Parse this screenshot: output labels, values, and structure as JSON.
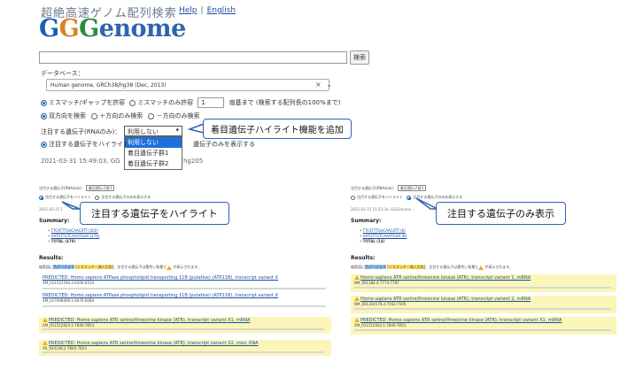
{
  "header": {
    "logo_subtitle": "超絶高速ゲノム配列検索",
    "logo": {
      "g1": "G",
      "g2": "G",
      "g3": "G",
      "rest": "enome"
    },
    "help_link": "Help",
    "separator": "|",
    "english_link": "English"
  },
  "search": {
    "button_label": "検索"
  },
  "database": {
    "label": "データベース：",
    "selected": "Human genome, GRCh38/hg38 (Dec, 2013)"
  },
  "options": {
    "mismatch_gap": "ミスマッチ/ギャップを許容",
    "mismatch_only": "ミスマッチのみ許容",
    "count_value": "1",
    "count_suffix": "塩基まで (検索する配列長の100%まで)",
    "both_strands": "双方向を検索",
    "plus_only": "＋方向のみ検索",
    "minus_only": "－方向のみ検索"
  },
  "gene_filter": {
    "label": "注目する遺伝子(RNAのみ)：",
    "selected": "利用しない",
    "options": [
      "利用しない",
      "着目遺伝子群1",
      "着目遺伝子群2"
    ],
    "highlight_radio": "注目する遺伝子をハイライト",
    "show_only_radio": "遺伝子のみを表示する"
  },
  "timestamp": "2021-03-31 15:49:03, GG",
  "timestamp_tail": "hg205",
  "callouts": {
    "top": "着目遺伝子ハイライト機能を追加",
    "left": "注目する遺伝子をハイライト",
    "right": "注目する遺伝子のみ表示"
  },
  "left_panel": {
    "filter_label": "注目する遺伝子(RNAのみ)：",
    "filter_selected": "着目遺伝子群1",
    "radio1": "注目する遺伝子をハイライト",
    "radio2": "注目する遺伝子のみを表示する",
    "timestamp": "2021-03-31 1",
    "summary_title": "Summary:",
    "summary_rows": [
      "TTCATTTGACAACATT (202)",
      "AATGTTGTCAAATGAA (276)",
      "TOTAL (478)"
    ],
    "results_title": "Results:",
    "legend": {
      "prefix": "検索語に",
      "mark1": "色がつきます",
      "mark2": "[ミスマッチ・挿入欠失]",
      "text": "、注目する遺伝子は黄色い背景と",
      "suffix": "が表示されます。"
    },
    "results": [
      {
        "title": "PREDICTED: Homo sapiens ATPase phospholipid transporting 11B (putative) (ATP11B), transcript variant X",
        "loc": "XM_011512594.2:6300-6314",
        "warn": false
      },
      {
        "title": "PREDICTED: Homo sapiens ATPase phospholipid transporting 11B (putative) (ATP11B), transcript variant X",
        "loc": "XM_017006009.1:6070-6084",
        "warn": false
      },
      {
        "title": "PREDICTED: Homo sapiens ATR serine/threonine kinase (ATR), transcript variant X1, mRNA",
        "loc": "XM_011512924.1:7840-7853",
        "warn": true
      },
      {
        "title": "PREDICTED: Homo sapiens ATR serine/threonine kinase (ATR), transcript variant X2, misc_RNA",
        "loc": "XR_924148.2:7840-7853",
        "warn": true
      }
    ]
  },
  "right_panel": {
    "filter_label": "注目する遺伝子(RNAのみ)：",
    "filter_selected": "着目遺伝子群1",
    "radio1": "注目する遺伝子をハイライト",
    "radio2": "注目する遺伝子のみを表示する",
    "timestamp": "2021-03-31 15:53:34, GGGenome :",
    "summary_title": "Summary:",
    "summary_rows": [
      "TTCATTTGACAACATT (6)",
      "AATGTTGTCAAATGAA (8)",
      "TOTAL (14)"
    ],
    "results_title": "Results:",
    "legend": {
      "prefix": "検索語に",
      "mark1": "色がつきます",
      "mark2": "[ミスマッチ・挿入欠失]",
      "text": "、注目する遺伝子は黄色い背景と",
      "suffix": "が表示されます。"
    },
    "results": [
      {
        "title": "Homo sapiens ATR serine/threonine kinase (ATR), transcript variant 1, mRNA",
        "loc": "NM_001184.4:7774-7787"
      },
      {
        "title": "Homo sapiens ATR serine/threonine kinase (ATR), transcript variant 2, mRNA",
        "loc": "NM_001354579.2:7562-7595"
      },
      {
        "title": "PREDICTED: Homo sapiens ATR serine/threonine kinase (ATR), transcript variant X1, mRNA",
        "loc": "XM_011512924.1:7840-7853"
      }
    ]
  }
}
